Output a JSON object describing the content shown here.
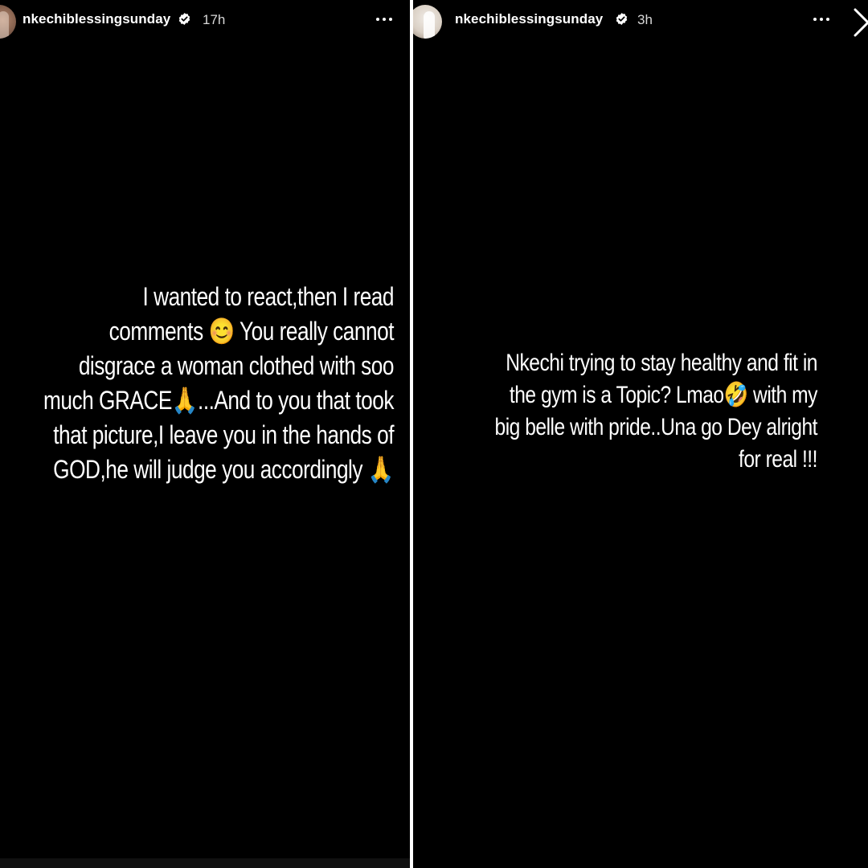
{
  "stories": [
    {
      "username": "nkechiblessingsunday",
      "verified_icon": "verified-badge-icon",
      "timestamp": "17h",
      "more_icon": "more-options-icon",
      "caption_lines": [
        "I wanted to react,then I read",
        "comments 😊 You really cannot",
        "disgrace a woman clothed with soo",
        "much GRACE🙏...And to you that took",
        "that picture,I leave you in the hands of",
        "GOD,he will judge you accordingly 🙏"
      ]
    },
    {
      "username": "nkechiblessingsunday",
      "verified_icon": "verified-badge-icon",
      "timestamp": "3h",
      "more_icon": "more-options-icon",
      "next_icon": "chevron-right-icon",
      "caption_lines": [
        "Nkechi trying to stay healthy and fit in",
        "the gym is a Topic? Lmao🤣 with my",
        "big belle with pride..Una go Dey alright",
        "for real !!!"
      ]
    }
  ],
  "colors": {
    "background": "#000000",
    "text": "#ffffff",
    "divider": "#ffffff"
  }
}
